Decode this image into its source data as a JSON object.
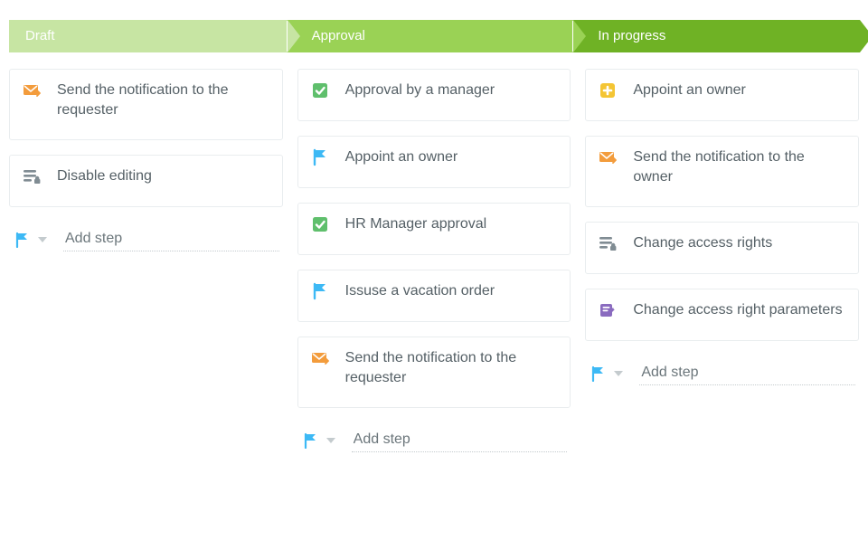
{
  "stages": {
    "draft": {
      "title": "Draft"
    },
    "approval": {
      "title": "Approval"
    },
    "inprogress": {
      "title": "In progress"
    }
  },
  "colors": {
    "stage_draft": "#c7e5a3",
    "stage_approval": "#9ad255",
    "stage_inprogress": "#6fb225",
    "icon_orange": "#f39c3c",
    "icon_green": "#5fbf6c",
    "icon_blue": "#3db9f5",
    "icon_yellow": "#f4c534",
    "icon_grey": "#808c93",
    "icon_purple": "#8a6bbf"
  },
  "add_step": {
    "placeholder": "Add step"
  },
  "columns": {
    "draft": {
      "steps": [
        {
          "icon": "envelope-icon",
          "color": "orange",
          "label": "Send the notification to the requester"
        },
        {
          "icon": "lock-list-icon",
          "color": "grey",
          "label": "Disable editing"
        }
      ]
    },
    "approval": {
      "steps": [
        {
          "icon": "check-icon",
          "color": "green",
          "label": "Approval by a manager"
        },
        {
          "icon": "flag-icon",
          "color": "blue",
          "label": "Appoint an owner"
        },
        {
          "icon": "check-icon",
          "color": "green",
          "label": "HR Manager approval"
        },
        {
          "icon": "flag-icon",
          "color": "blue",
          "label": "Issuse a vacation order"
        },
        {
          "icon": "envelope-icon",
          "color": "orange",
          "label": "Send the notification to the requester"
        }
      ]
    },
    "inprogress": {
      "steps": [
        {
          "icon": "plus-icon",
          "color": "yellow",
          "label": "Appoint an owner"
        },
        {
          "icon": "envelope-icon",
          "color": "orange",
          "label": "Send the notification to the owner"
        },
        {
          "icon": "lock-list-icon",
          "color": "grey",
          "label": "Change access rights"
        },
        {
          "icon": "edit-icon",
          "color": "purple",
          "label": "Change access right parameters"
        }
      ]
    }
  }
}
